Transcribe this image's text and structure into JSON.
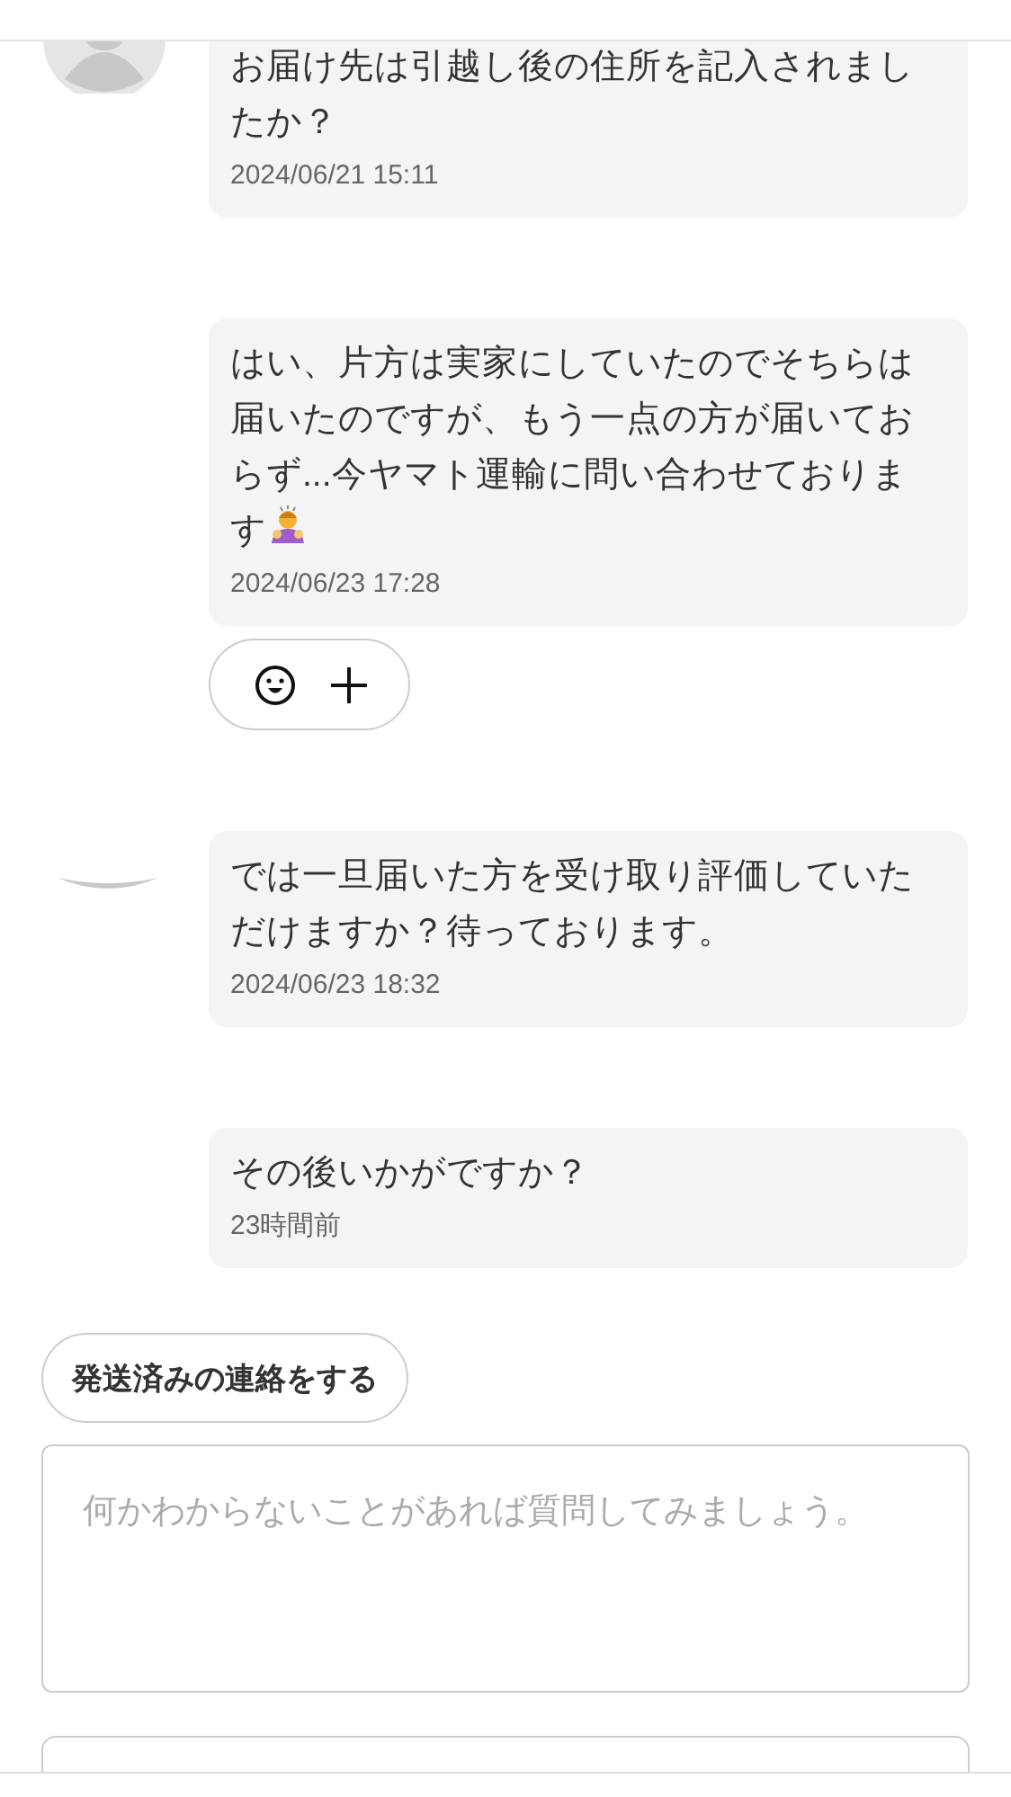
{
  "messages": [
    {
      "kind": "default-avatar",
      "text": "お届け先は引越し後の住所を記入されましたか？",
      "emoji": false,
      "time": "2024/06/21 15:11",
      "reactions": false
    },
    {
      "kind": "no-avatar",
      "text": "はい、片方は実家にしていたのでそちらは届いたのですが、もう一点の方が届いておらず...今ヤマト運輸に問い合わせております",
      "emoji": true,
      "time": "2024/06/23 17:28",
      "reactions": true
    },
    {
      "kind": "photo-avatar",
      "text": "では一旦届いた方を受け取り評価していただけますか？待っております。",
      "emoji": false,
      "time": "2024/06/23 18:32",
      "reactions": false
    },
    {
      "kind": "no-avatar",
      "text": "その後いかがですか？",
      "emoji": false,
      "time": "23時間前",
      "reactions": false
    }
  ],
  "shipped_button": "発送済みの連絡をする",
  "message_field": {
    "placeholder": "何かわからないことがあれば質問してみましょう。"
  }
}
